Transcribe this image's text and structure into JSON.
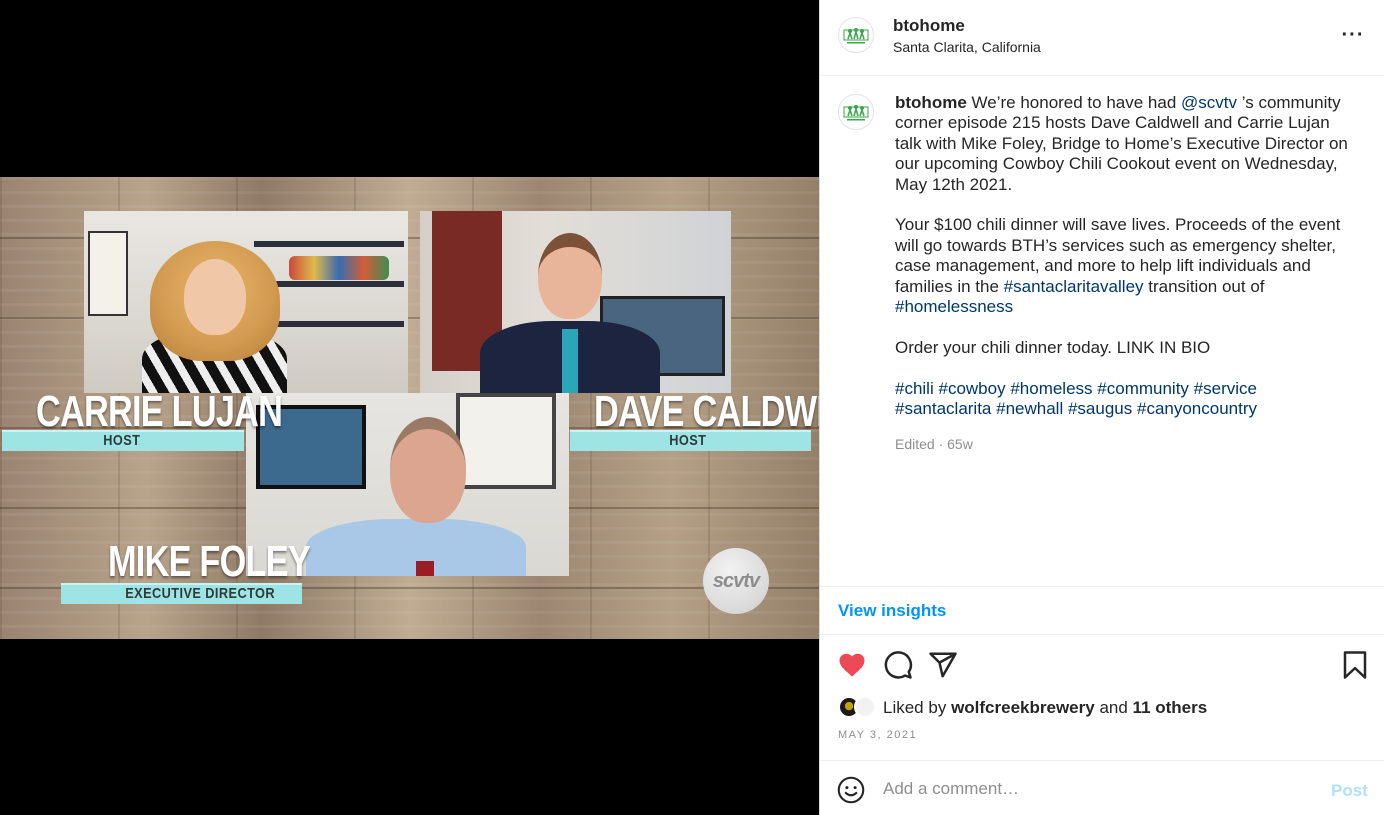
{
  "video": {
    "hosts": [
      {
        "name": "CARRIE LUJAN",
        "role": "HOST"
      },
      {
        "name": "DAVE CALDWELL",
        "role": "HOST"
      },
      {
        "name": "MIKE FOLEY",
        "role": "EXECUTIVE DIRECTOR"
      }
    ],
    "logo_text": "scvtv"
  },
  "header": {
    "username": "btohome",
    "location": "Santa Clarita, California",
    "more_label": "···"
  },
  "caption": {
    "username": "btohome",
    "p1_a": "We’re honored to have had",
    "mention": "@scvtv",
    "p1_b": "’s community corner episode 215 hosts Dave Caldwell and Carrie Lujan talk with Mike Foley, Bridge to Home’s Executive Director on our upcoming Cowboy Chili Cookout event on Wednesday, May 12th 2021.",
    "p2_a": "Your $100 chili dinner will save lives. Proceeds of the event will go towards BTH’s services such as emergency shelter, case management, and more to help lift individuals and families in the",
    "p2_tag1": "#santaclaritavalley",
    "p2_b": "transition out of",
    "p2_tag2": "#homelessness",
    "p3": "Order your chili dinner today. LINK IN BIO",
    "hashtags": [
      "#chili",
      "#cowboy",
      "#homeless",
      "#community",
      "#service",
      "#santaclarita",
      "#newhall",
      "#saugus",
      "#canyoncountry"
    ],
    "meta": "Edited · 65w"
  },
  "insights": {
    "label": "View insights"
  },
  "likes": {
    "prefix": "Liked by",
    "user": "wolfcreekbrewery",
    "middle": "and",
    "others": "11 others"
  },
  "date": "MAY 3, 2021",
  "comment": {
    "placeholder": "Add a comment…",
    "post_label": "Post"
  },
  "colors": {
    "like": "#ed4956",
    "link": "#00376b",
    "insights": "#0095f6",
    "post_disabled": "#b2dffc",
    "nameplate": "#9fe4e4"
  },
  "icons": [
    "heart-icon",
    "comment-icon",
    "share-icon",
    "bookmark-icon",
    "emoji-icon",
    "more-icon"
  ]
}
